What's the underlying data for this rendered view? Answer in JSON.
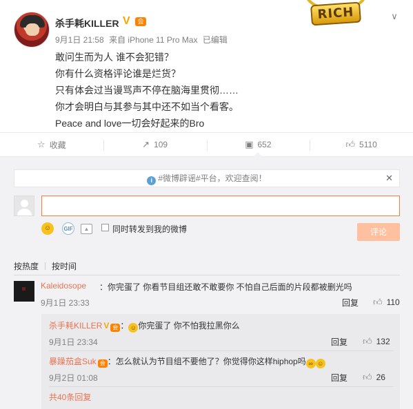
{
  "post": {
    "username": "杀手耗KILLER",
    "verified_badge": "V",
    "vip_badge": "会",
    "meta": {
      "date": "9月1日 21:58",
      "source": "来自 iPhone 11 Pro Max",
      "edited": "已编辑"
    },
    "lines": [
      "敢问生而为人 谁不会犯错？",
      "你有什么资格评论谁是烂货？",
      "只有体会过当谩骂声不停在脑海里贯彻……",
      "你才会明白与其参与其中还不如当个看客。",
      "Peace and love一切会好起来的Bro"
    ],
    "sticker_text": "RICH",
    "menu_icon": "chevron-down-icon"
  },
  "actions": {
    "favorite_label": "收藏",
    "repost_count": "109",
    "comment_count": "652",
    "like_count": "5110"
  },
  "comment_area": {
    "notice": "#微博辟谣#平台，欢迎查阅！",
    "input_value": "",
    "repost_option_label": "同时转发到我的微博",
    "submit_label": "评论",
    "sort_hot": "按热度",
    "sort_time": "按时间"
  },
  "comments": [
    {
      "user": "Kaleidosope",
      "text": "：你完蛋了 你看节目组还敢不敢要你 不怕自己后面的片段都被删光吗",
      "time": "9月1日 23:33",
      "reply_label": "回复",
      "likes": "110",
      "replies": [
        {
          "user": "杀手耗KILLER",
          "text": "你完蛋了 你不怕我拉黑你么",
          "time": "9月1日 23:34",
          "reply_label": "回复",
          "likes": "132"
        },
        {
          "user": "暴躁茄盒Suk",
          "text": "：怎么就认为节目组不要他了？你觉得你这样hiphop吗",
          "time": "9月2日 01:08",
          "reply_label": "回复",
          "likes": "26"
        }
      ],
      "total_replies": "共40条回复"
    }
  ]
}
